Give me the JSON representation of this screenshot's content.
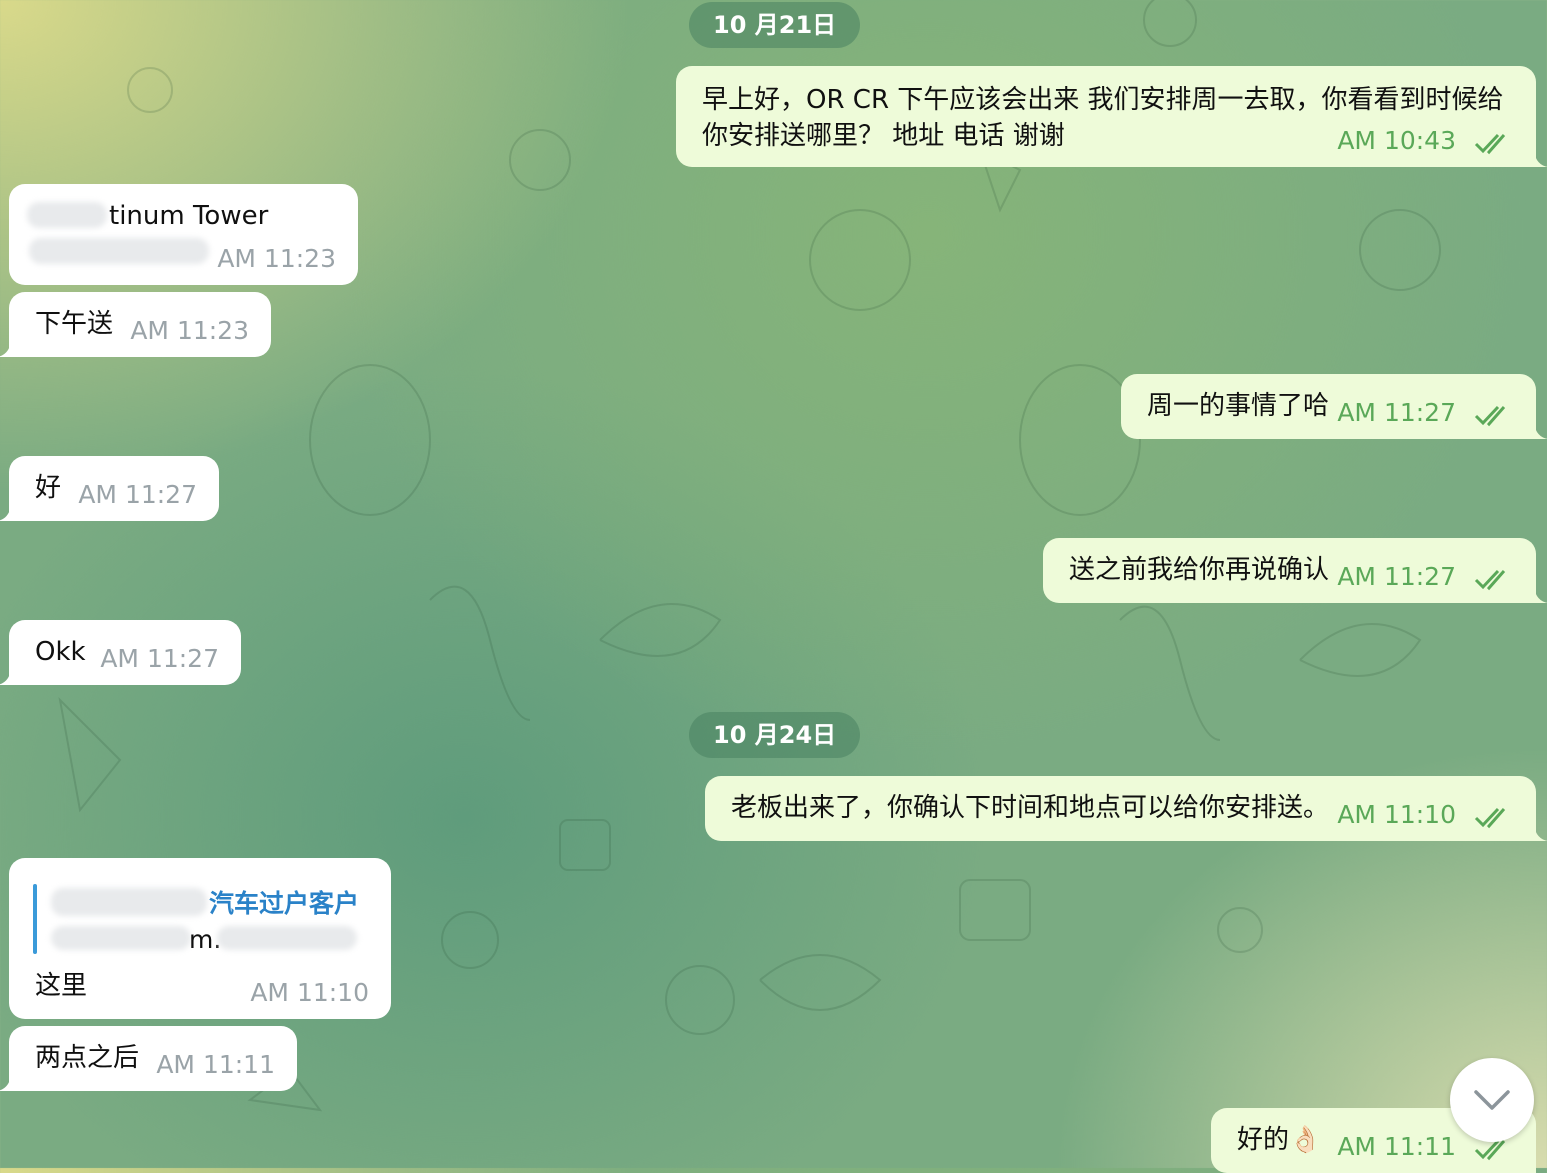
{
  "dates": [
    "10 月21日",
    "10 月24日"
  ],
  "messages": [
    {
      "dir": "out",
      "text_line1": "早上好，OR CR 下午应该会出来 我们安排周一去取，你看看到时候给",
      "text_line2": "你安排送哪里？ 地址 电话 谢谢",
      "time": "AM 10:43"
    },
    {
      "dir": "in",
      "text_line1": "tinum Tower",
      "time": "AM 11:23"
    },
    {
      "dir": "in",
      "text": "下午送",
      "time": "AM 11:23"
    },
    {
      "dir": "out",
      "text": "周一的事情了哈",
      "time": "AM 11:27"
    },
    {
      "dir": "in",
      "text": "好",
      "time": "AM 11:27"
    },
    {
      "dir": "out",
      "text": "送之前我给你再说确认",
      "time": "AM 11:27"
    },
    {
      "dir": "in",
      "text": "Okk",
      "time": "AM 11:27"
    },
    {
      "dir": "out",
      "text": "老板出来了，你确认下时间和地点可以给你安排送。",
      "time": "AM 11:10"
    },
    {
      "dir": "in",
      "reply_title": "汽车过户客户",
      "reply_text": "m.",
      "text": "这里",
      "time": "AM 11:10"
    },
    {
      "dir": "in",
      "text": "两点之后",
      "time": "AM 11:11"
    },
    {
      "dir": "out",
      "text": "好的👌🏻",
      "time": "AM 11:11"
    }
  ],
  "icons": {
    "read_receipt": "double-check-icon",
    "scroll": "chevron-down-icon"
  },
  "colors": {
    "out_bubble": "#eefbd9",
    "in_bubble": "#ffffff",
    "out_time": "#5aa858",
    "in_time": "#9aa3a8",
    "reply_accent": "#2a82c8"
  }
}
